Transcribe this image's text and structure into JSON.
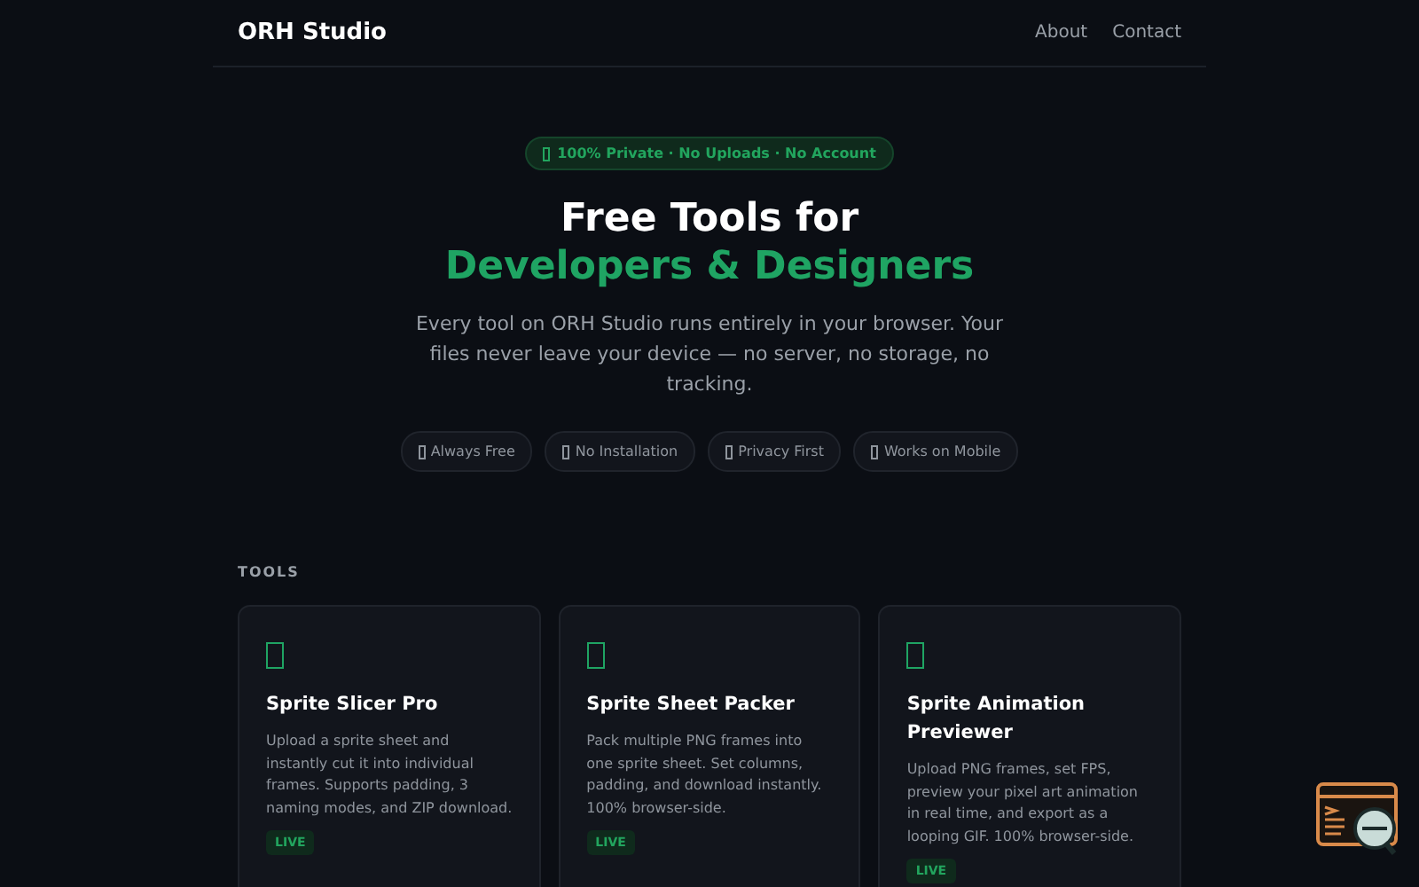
{
  "header": {
    "brand": "ORH Studio",
    "nav": [
      "About",
      "Contact"
    ]
  },
  "hero": {
    "badge": "100% Private · No Uploads · No Account",
    "title_line": "Free Tools for",
    "title_accent": "Developers & Designers",
    "description": "Every tool on ORH Studio runs entirely in your browser. Your files never leave your device — no server, no storage, no tracking.",
    "features": [
      "Always Free",
      "No Installation",
      "Privacy First",
      "Works on Mobile"
    ]
  },
  "tools": {
    "heading": "TOOLS",
    "cards": [
      {
        "title": "Sprite Slicer Pro",
        "description": "Upload a sprite sheet and instantly cut it into individual frames. Supports padding, 3 naming modes, and ZIP download.",
        "status": "LIVE"
      },
      {
        "title": "Sprite Sheet Packer",
        "description": "Pack multiple PNG frames into one sprite sheet. Set columns, padding, and download instantly. 100% browser-side.",
        "status": "LIVE"
      },
      {
        "title": "Sprite Animation Previewer",
        "description": "Upload PNG frames, set FPS, preview your pixel art animation in real time, and export as a looping GIF. 100% browser-side.",
        "status": "LIVE"
      }
    ]
  }
}
